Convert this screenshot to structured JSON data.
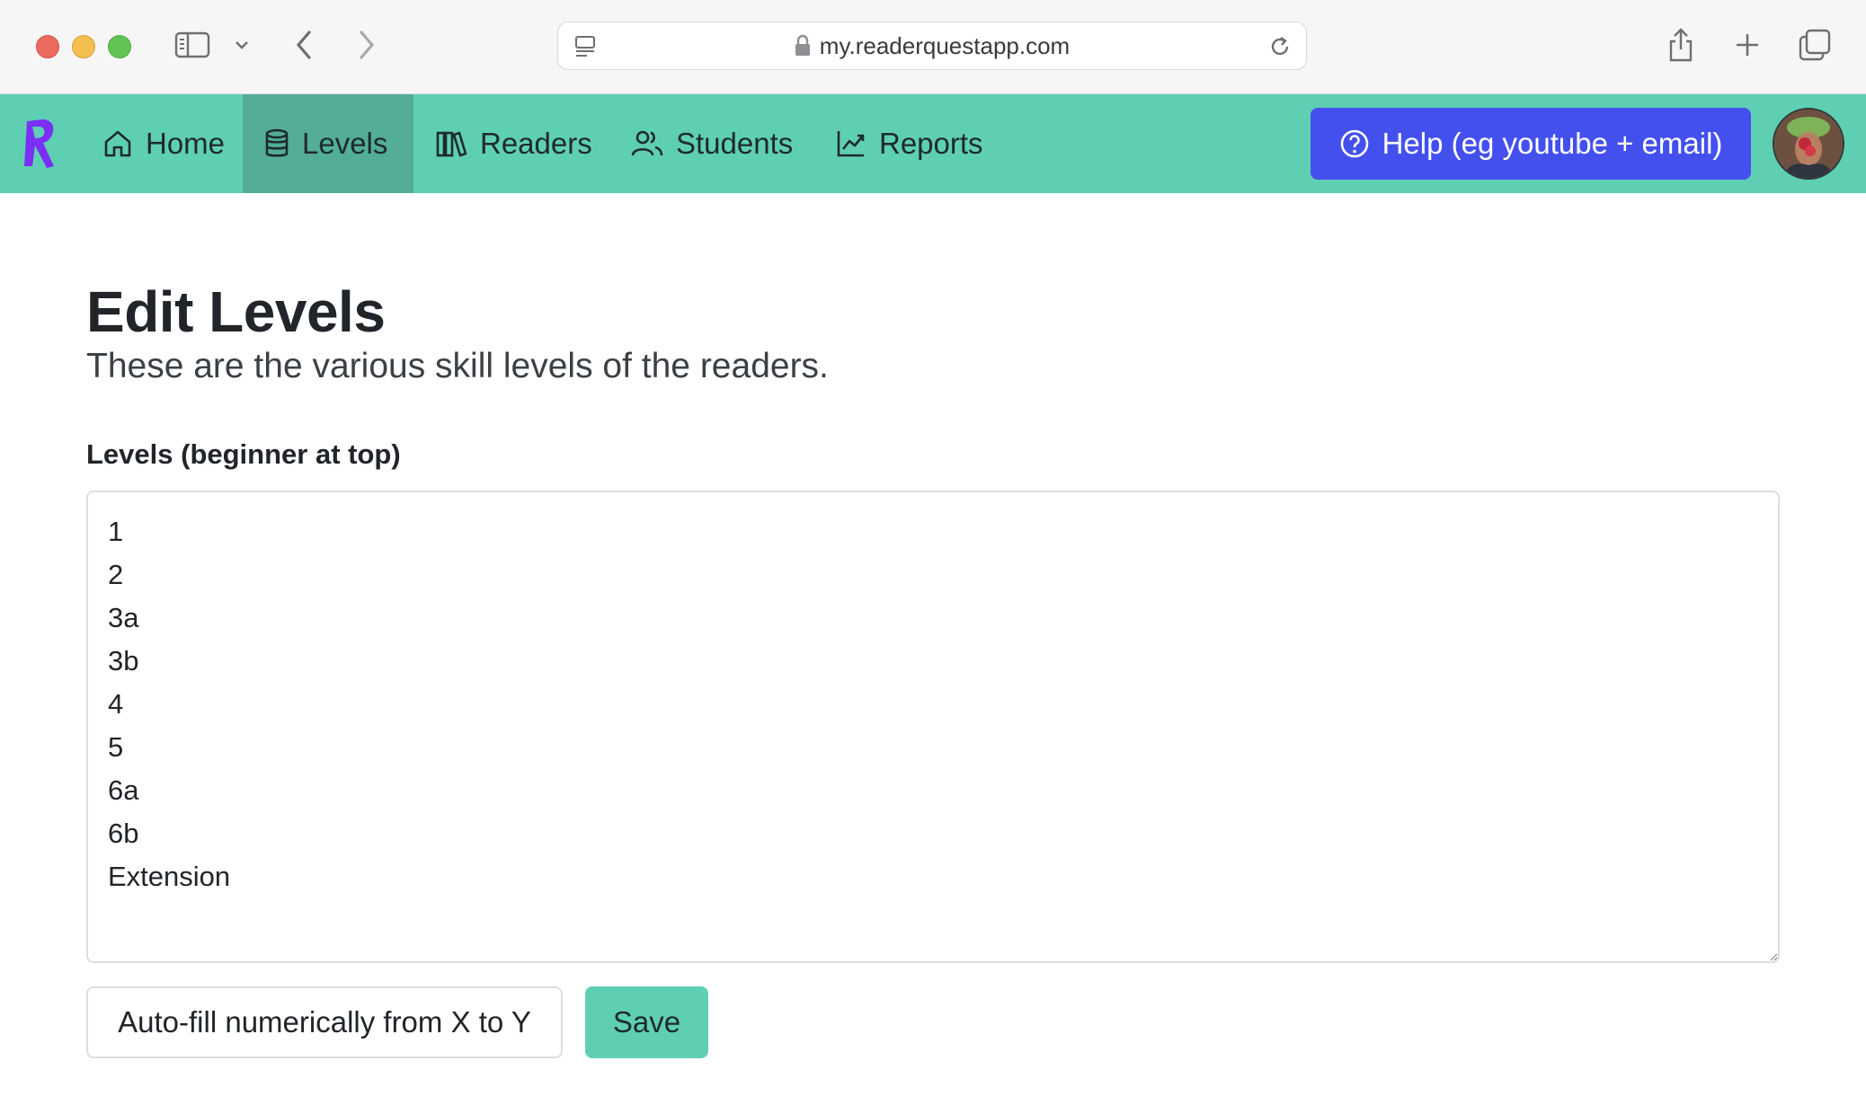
{
  "browser": {
    "url": "my.readerquestapp.com",
    "icons": [
      "sidebar-icon",
      "chevron-down-icon",
      "back-arrow-icon",
      "forward-arrow-icon",
      "page-menu-icon",
      "lock-icon",
      "reload-icon",
      "share-icon",
      "new-tab-icon",
      "tab-overview-icon"
    ]
  },
  "navbar": {
    "items": [
      {
        "label": "Home",
        "icon": "home-icon",
        "active": false
      },
      {
        "label": "Levels",
        "icon": "database-icon",
        "active": true
      },
      {
        "label": "Readers",
        "icon": "books-icon",
        "active": false
      },
      {
        "label": "Students",
        "icon": "users-icon",
        "active": false
      },
      {
        "label": "Reports",
        "icon": "chart-line-icon",
        "active": false
      }
    ],
    "help_label": "Help (eg youtube + email)",
    "colors": {
      "navbar": "#5fcfb4",
      "active": "#53ad98",
      "help": "#4450ee",
      "brand": "#7b2ff7"
    }
  },
  "page": {
    "title": "Edit Levels",
    "subtitle": "These are the various skill levels of the readers.",
    "levels_label": "Levels (beginner at top)",
    "levels_value": "1\n2\n3a\n3b\n4\n5\n6a\n6b\nExtension",
    "autofill_label": "Auto-fill numerically from X to Y",
    "save_label": "Save"
  }
}
